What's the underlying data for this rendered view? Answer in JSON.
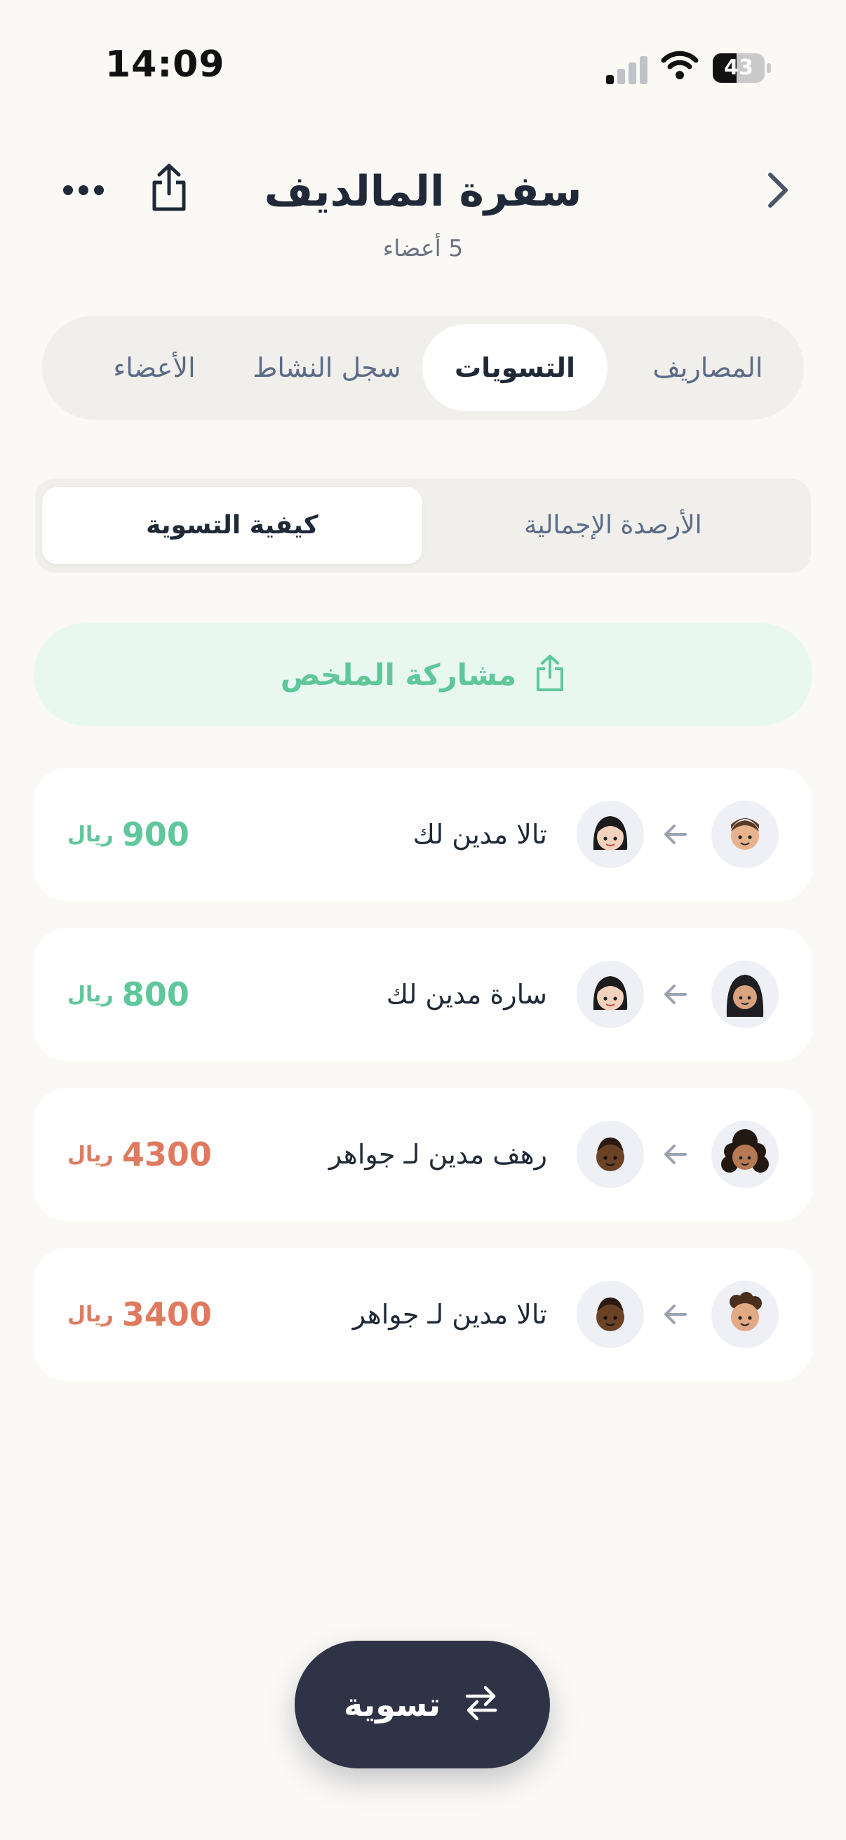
{
  "status_bar": {
    "time": "14:09",
    "battery": "43"
  },
  "header": {
    "title": "سفرة المالديف",
    "subtitle": "5 أعضاء"
  },
  "tabs": [
    {
      "label": "المصاريف",
      "active": false
    },
    {
      "label": "التسويات",
      "active": true
    },
    {
      "label": "سجل النشاط",
      "active": false
    },
    {
      "label": "الأعضاء",
      "active": false
    }
  ],
  "segmented": {
    "total_balances": "الأرصدة الإجمالية",
    "how_to_settle": "كيفية التسوية",
    "selected": "كيفية التسوية"
  },
  "share_summary": {
    "label": "مشاركة الملخص"
  },
  "settlements": [
    {
      "text": "تالا مدين لك",
      "amount": "900",
      "currency": "ريال",
      "status": "owed-to-you",
      "color": "#5fc79a"
    },
    {
      "text": "سارة مدين لك",
      "amount": "800",
      "currency": "ريال",
      "status": "owed-to-you",
      "color": "#5fc79a"
    },
    {
      "text": "رهف مدين لـ جواهر",
      "amount": "4300",
      "currency": "ريال",
      "status": "between-others",
      "color": "#df7a5f"
    },
    {
      "text": "تالا مدين لـ جواهر",
      "amount": "3400",
      "currency": "ريال",
      "status": "between-others",
      "color": "#df7a5f"
    }
  ],
  "settle_button": {
    "label": "تسوية"
  },
  "colors": {
    "positive": "#5fc79a",
    "negative": "#df7a5f",
    "dark_button": "#2e3445",
    "background": "#faf9f6"
  }
}
